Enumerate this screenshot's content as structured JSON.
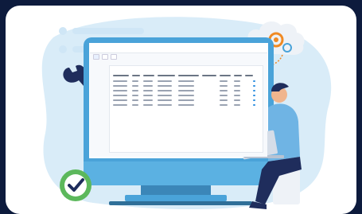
{
  "colors": {
    "background": "#0d1b3d",
    "card": "#ffffff",
    "blob": "#d9ecf8",
    "monitor_frame": "#4aa3d9",
    "accent_orange": "#f08a24",
    "badge_green": "#5cb85c",
    "wrench": "#1f2d5c"
  },
  "app": {
    "title": "",
    "tabs": [
      {
        "label": ""
      },
      {
        "label": ""
      },
      {
        "label": ""
      }
    ],
    "table_rows": 7
  },
  "icons": [
    "wrench-icon",
    "gear-check-icon",
    "cloud-gears-icon",
    "laptop-icon"
  ]
}
